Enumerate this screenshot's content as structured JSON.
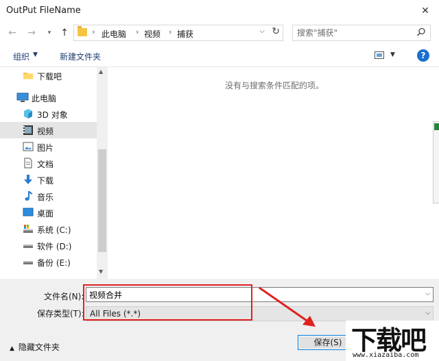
{
  "window": {
    "title": "OutPut FileName",
    "close_glyph": "✕"
  },
  "nav": {
    "breadcrumb": [
      "此电脑",
      "视频",
      "捕获"
    ],
    "search_placeholder": "搜索\"捕获\""
  },
  "toolbar": {
    "organize": "组织",
    "new_folder": "新建文件夹",
    "help": "?"
  },
  "sidebar": {
    "items": [
      {
        "label": "下载吧",
        "icon": "folder-icon"
      },
      {
        "label": "此电脑",
        "icon": "computer-icon"
      },
      {
        "label": "3D 对象",
        "icon": "cube-3d-icon"
      },
      {
        "label": "视频",
        "icon": "video-icon",
        "selected": true
      },
      {
        "label": "图片",
        "icon": "picture-icon"
      },
      {
        "label": "文档",
        "icon": "document-icon"
      },
      {
        "label": "下载",
        "icon": "download-icon"
      },
      {
        "label": "音乐",
        "icon": "music-icon"
      },
      {
        "label": "桌面",
        "icon": "desktop-icon"
      },
      {
        "label": "系统 (C:)",
        "icon": "drive-c-icon"
      },
      {
        "label": "软件 (D:)",
        "icon": "drive-icon"
      },
      {
        "label": "备份 (E:)",
        "icon": "drive-icon"
      }
    ]
  },
  "content": {
    "empty_message": "没有与搜索条件匹配的项。"
  },
  "form": {
    "filename_label": "文件名(N):",
    "filename_value": "视频合并",
    "filetype_label": "保存类型(T):",
    "filetype_value": "All Files (*.*)"
  },
  "footer": {
    "hide_folders": "隐藏文件夹",
    "save": "保存(S)"
  },
  "watermark": {
    "logo": "下载吧",
    "url": "www.xiazaiba.com"
  },
  "colors": {
    "accent": "#0078d7",
    "annotation": "#e02020",
    "selection": "#cce8ff"
  }
}
